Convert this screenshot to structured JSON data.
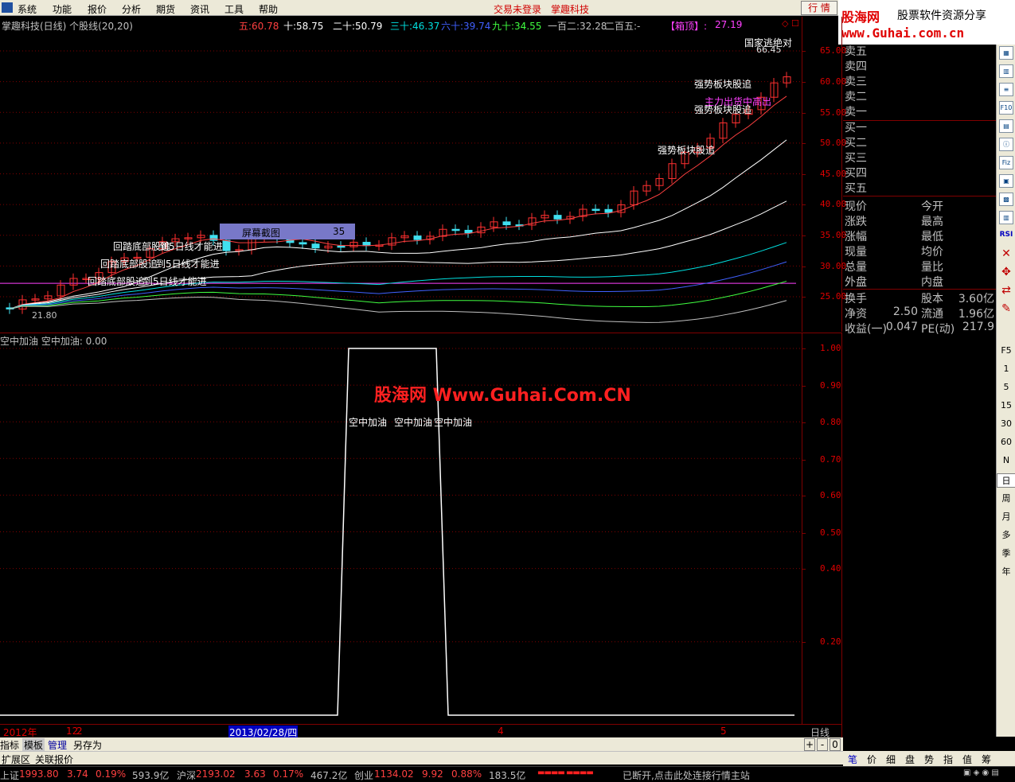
{
  "menubar": {
    "items": [
      "系统",
      "功能",
      "报价",
      "分析",
      "期货",
      "资讯",
      "工具",
      "帮助"
    ],
    "status": "交易未登录",
    "company": "掌趣科技",
    "trade_button": "行 情"
  },
  "logo": {
    "brand": "股海网",
    "slogan": "股票软件资源分享",
    "url": "www.Guhai.com.cn"
  },
  "chart_header": {
    "title": "掌趣科技(日线) 个股线(20,20)",
    "ma": [
      {
        "label": "五:",
        "value": "60.78",
        "color": "#ff4040"
      },
      {
        "label": "十:",
        "value": "58.75",
        "color": "#ffffff"
      },
      {
        "label": "二十:",
        "value": "50.79",
        "color": "#ffffff"
      },
      {
        "label": "三十:",
        "value": "46.37",
        "color": "#00e0e0"
      },
      {
        "label": "六十:",
        "value": "39.74",
        "color": "#4060ff"
      },
      {
        "label": "九十:",
        "value": "34.55",
        "color": "#40ff40"
      },
      {
        "label": "一百二:",
        "value": "32.28",
        "color": "#c0c0c0"
      },
      {
        "label": "二百五:",
        "value": "-",
        "color": "#c0c0c0"
      }
    ],
    "box_label": "【箱顶】:",
    "box_value": "27.19"
  },
  "price_axis": {
    "labels": [
      "65.00",
      "60.00",
      "55.00",
      "50.00",
      "45.00",
      "40.00",
      "35.00",
      "30.00",
      "25.00"
    ]
  },
  "sub_axis": {
    "labels": [
      "1.00",
      "0.90",
      "0.80",
      "0.70",
      "0.60",
      "0.50",
      "0.40",
      "0.20"
    ]
  },
  "sub_header": "空中加油  空中加油: 0.00",
  "annotations": {
    "high": "66.45",
    "low": "21.80",
    "text_national": "国家逃绝对",
    "text_strong": "强势板块股追",
    "text_screen": "屏幕截图",
    "text_screen_val": "35",
    "text_main_flow": "主力出货中高出",
    "text_ma5": "到5日线才能进",
    "text_pullback": "回踏底部股追",
    "text_refuel": "空中加油",
    "watermark": "股海网 Www.Guhai.Com.CN"
  },
  "date_bar": {
    "labels": [
      "2012年",
      "12",
      "2",
      "2013/02/28/四",
      "4",
      "5"
    ],
    "period": "日线"
  },
  "tabs": [
    "指标",
    "模板",
    "管理",
    "另存为"
  ],
  "ext_tabs": [
    "扩展区",
    "关联报价"
  ],
  "zoom": [
    "+",
    "-",
    "0"
  ],
  "order_book": {
    "asks": [
      "卖五",
      "卖四",
      "卖三",
      "卖二",
      "卖一"
    ],
    "bids": [
      "买一",
      "买二",
      "买三",
      "买四",
      "买五"
    ]
  },
  "quote": {
    "rows": [
      [
        "现价",
        "",
        "今开",
        ""
      ],
      [
        "涨跌",
        "",
        "最高",
        ""
      ],
      [
        "涨幅",
        "",
        "最低",
        ""
      ],
      [
        "现量",
        "",
        "均价",
        ""
      ],
      [
        "总量",
        "",
        "量比",
        ""
      ],
      [
        "外盘",
        "",
        "内盘",
        ""
      ],
      [
        "换手",
        "",
        "股本",
        "3.60亿"
      ],
      [
        "净资",
        "2.50",
        "流通",
        "1.96亿"
      ],
      [
        "收益(一)",
        "0.047",
        "PE(动)",
        "217.9"
      ]
    ]
  },
  "right_toolbar": {
    "texts": [
      "F5",
      "1",
      "5",
      "15",
      "30",
      "60",
      "N",
      "日",
      "周",
      "月",
      "多",
      "季",
      "年"
    ],
    "icons": [
      "RSI"
    ]
  },
  "bottom_tabs": [
    "笔",
    "价",
    "细",
    "盘",
    "势",
    "指",
    "值",
    "筹"
  ],
  "status_bar": {
    "sh_label": "上证",
    "sh_price": "1993.80",
    "sh_chg": "3.74",
    "sh_pct": "0.19%",
    "sh_amt": "593.9亿",
    "sz_label": "沪深",
    "sz_price": "2193.02",
    "sz_chg": "3.63",
    "sz_pct": "0.17%",
    "sz_amt": "467.2亿",
    "cy_label": "创业",
    "cy_price": "1134.02",
    "cy_chg": "9.92",
    "cy_pct": "0.88%",
    "cy_amt": "183.5亿",
    "disconnect": "已断开,点击此处连接行情主站"
  }
}
